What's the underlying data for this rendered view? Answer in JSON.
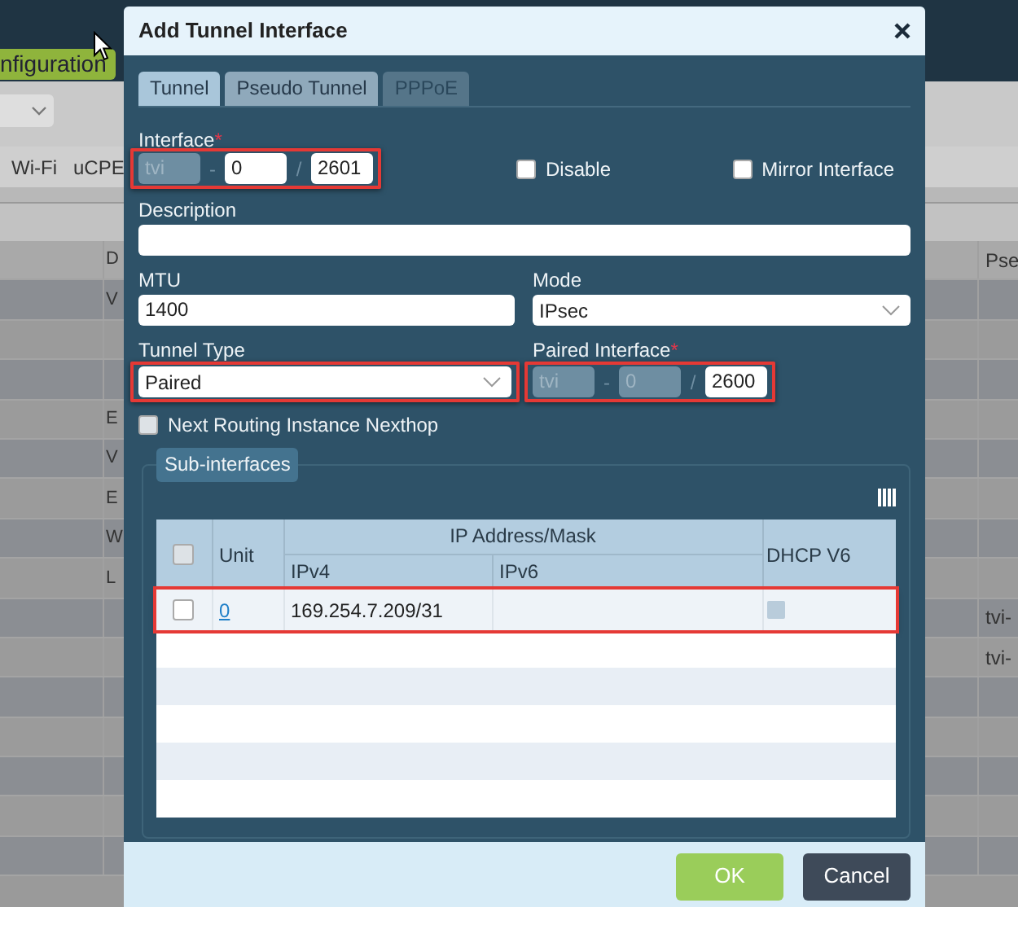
{
  "background": {
    "menu_button": "nfiguration",
    "nav_items": [
      "Wi-Fi",
      "uCPE"
    ],
    "table": {
      "column_1": "D",
      "column_2": "Pse",
      "rows": [
        {
          "column_1": "V"
        },
        {},
        {},
        {
          "column_1": "E"
        },
        {
          "column_1": "V"
        },
        {
          "column_1": "E"
        },
        {
          "column_1": "W"
        },
        {
          "column_1": "L"
        },
        {
          "column_2": "tvi-"
        },
        {
          "column_2": "tvi-"
        },
        {},
        {},
        {},
        {},
        {}
      ]
    }
  },
  "dialog": {
    "title": "Add Tunnel Interface",
    "tabs": [
      {
        "label": "Tunnel",
        "selected": true,
        "disabled": false
      },
      {
        "label": "Pseudo Tunnel",
        "selected": false,
        "disabled": false
      },
      {
        "label": "PPPoE",
        "selected": false,
        "disabled": true
      }
    ],
    "interface": {
      "label": "Interface",
      "required_mark": "*",
      "highlighted": true,
      "parts": [
        {
          "value": "tvi",
          "disabled": true
        },
        {
          "separator": "-",
          "value": "0",
          "disabled": false
        },
        {
          "separator": "/",
          "value": "2601",
          "disabled": false
        }
      ]
    },
    "checkboxes": [
      {
        "label": "Disable",
        "checked": false
      },
      {
        "label": "Mirror Interface",
        "checked": false
      }
    ],
    "description": {
      "label": "Description"
    },
    "mtu": {
      "label": "MTU",
      "value": "1400"
    },
    "mode": {
      "label": "Mode",
      "value": "IPsec"
    },
    "tunnel_type": {
      "label": "Tunnel Type",
      "value": "Paired",
      "highlighted": true
    },
    "paired_interface": {
      "label": "Paired Interface",
      "required_mark": "*",
      "highlighted": true,
      "parts": [
        {
          "value": "tvi",
          "disabled": true
        },
        {
          "separator": "-",
          "value": "0",
          "disabled": true
        },
        {
          "separator": "/",
          "value": "2600",
          "disabled": false
        }
      ]
    },
    "next_routing": {
      "label": "Next Routing Instance Nexthop",
      "checked": false
    },
    "sub_interfaces": {
      "title": "Sub-interfaces",
      "table": {
        "select_all_checked": false,
        "group_header": "IP Address/Mask",
        "columns": [
          "Unit",
          "IPv4",
          "IPv6",
          "DHCP V6"
        ],
        "rows": [
          {
            "unit": "0",
            "ipv4": "169.254.7.209/31",
            "checked": false,
            "dhcp_v6": false,
            "highlighted": true
          }
        ]
      }
    },
    "buttons": [
      {
        "label": "OK",
        "kind": "primary"
      },
      {
        "label": "Cancel",
        "kind": "secondary"
      }
    ]
  }
}
